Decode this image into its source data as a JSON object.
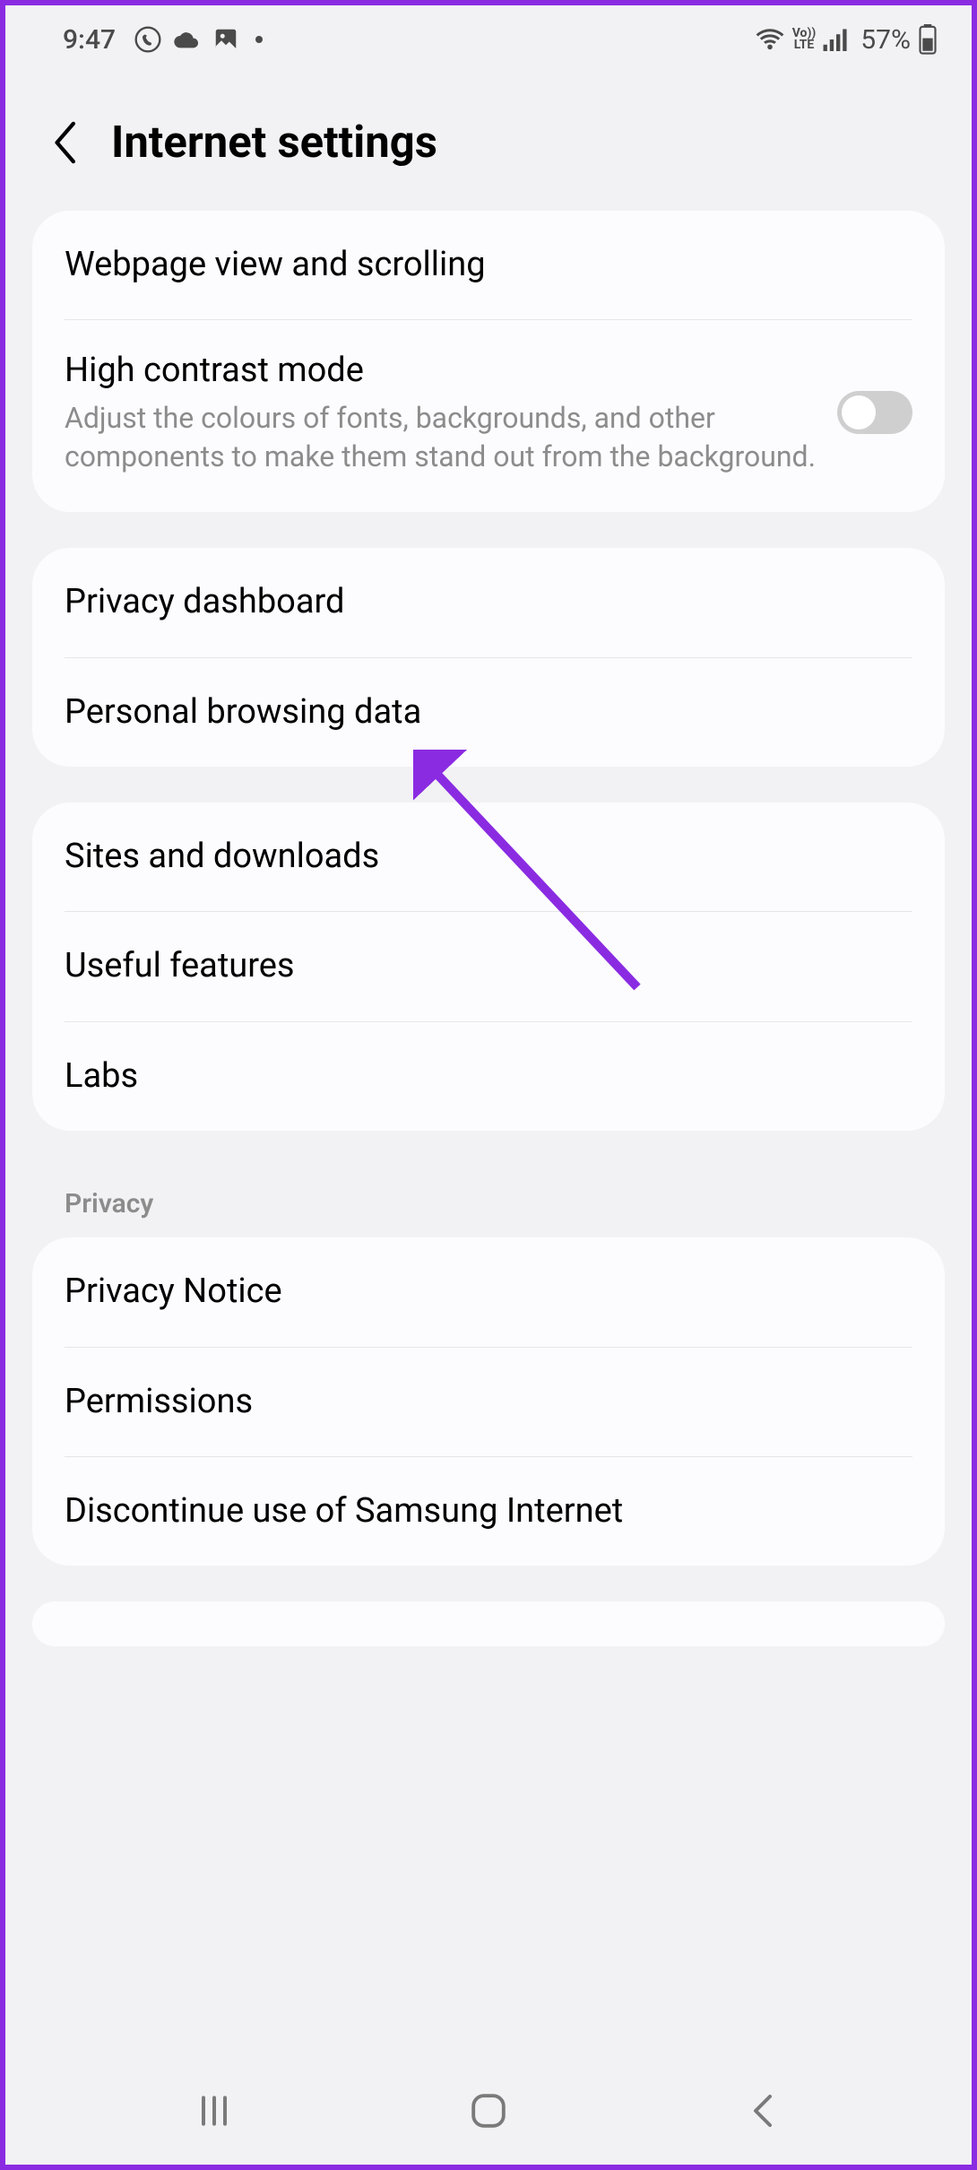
{
  "status": {
    "time": "9:47",
    "battery": "57%"
  },
  "header": {
    "title": "Internet settings"
  },
  "group1": {
    "webpage": {
      "title": "Webpage view and scrolling"
    },
    "contrast": {
      "title": "High contrast mode",
      "sub": "Adjust the colours of fonts, backgrounds, and other components to make them stand out from the background."
    }
  },
  "group2": {
    "dashboard": {
      "title": "Privacy dashboard"
    },
    "browsing": {
      "title": "Personal browsing data"
    }
  },
  "group3": {
    "sites": {
      "title": "Sites and downloads"
    },
    "useful": {
      "title": "Useful features"
    },
    "labs": {
      "title": "Labs"
    }
  },
  "privacy_label": "Privacy",
  "group4": {
    "notice": {
      "title": "Privacy Notice"
    },
    "perms": {
      "title": "Permissions"
    },
    "discontinue": {
      "title": "Discontinue use of Samsung Internet"
    }
  }
}
